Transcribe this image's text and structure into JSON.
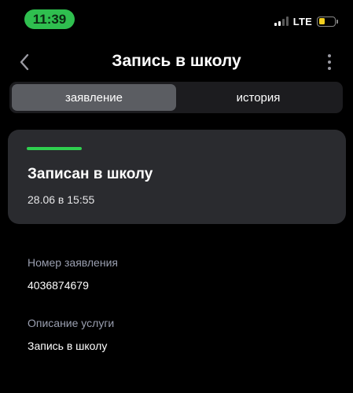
{
  "status_bar": {
    "time": "11:39",
    "network": "LTE",
    "battery_level": 0.4,
    "colors": {
      "time_pill": "#2fbf4f",
      "battery": "#f2cf1f"
    }
  },
  "nav": {
    "back_icon": "chevron-left-icon",
    "title": "Запись в школу",
    "more_icon": "more-vertical-icon"
  },
  "tabs": [
    {
      "label": "заявление",
      "active": true
    },
    {
      "label": "история",
      "active": false
    }
  ],
  "status_card": {
    "title": "Записан в школу",
    "date": "28.06 в 15:55",
    "accent_color": "#2fcf4f"
  },
  "fields": [
    {
      "label": "Номер заявления",
      "value": "4036874679"
    },
    {
      "label": "Описание услуги",
      "value": "Запись в школу"
    }
  ]
}
